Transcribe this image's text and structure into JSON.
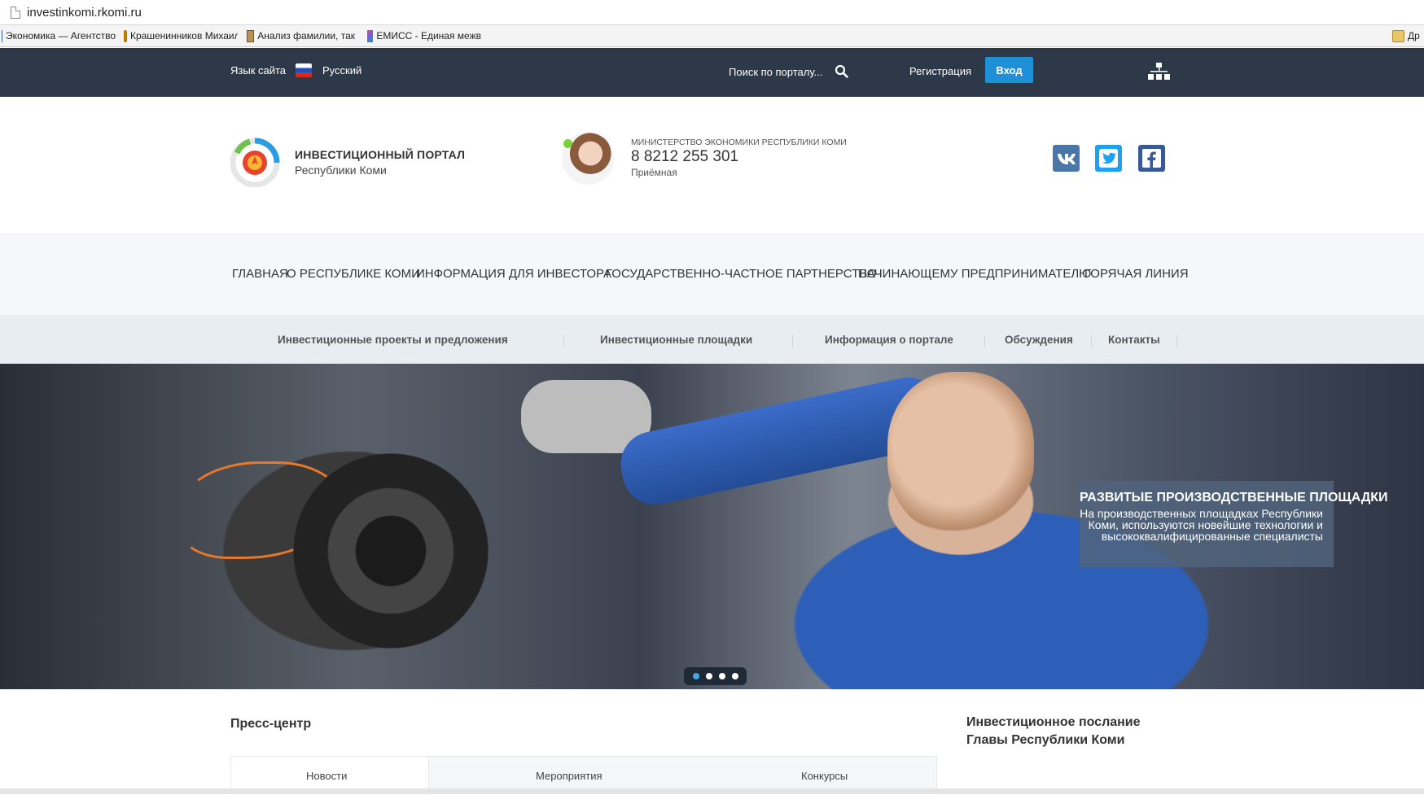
{
  "browser": {
    "url": "investinkomi.rkomi.ru",
    "bookmarks": [
      {
        "label": "Экономика — Агентство",
        "icon": "bar-chart-icon"
      },
      {
        "label": "Крашенинников Михаил",
        "icon": "odnoklassniki-icon"
      },
      {
        "label": "Анализ фамилии, так",
        "icon": "book-icon"
      },
      {
        "label": "ЕМИСС - Единая межв",
        "icon": "emiss-icon"
      },
      {
        "label": "Др",
        "icon": "folder-icon"
      }
    ]
  },
  "topbar": {
    "language_label": "Язык сайта",
    "language_value": "Русский",
    "search_placeholder": "Поиск по порталу...",
    "register_label": "Регистрация",
    "login_label": "Вход"
  },
  "header": {
    "portal_title": "ИНВЕСТИЦИОННЫЙ ПОРТАЛ",
    "portal_subtitle": "Республики Коми",
    "ministry": "МИНИСТЕРСТВО ЭКОНОМИКИ РЕСПУБЛИКИ КОМИ",
    "phone": "8 8212 255 301",
    "phone_note": "Приёмная",
    "social": [
      "vk-icon",
      "twitter-icon",
      "facebook-icon"
    ]
  },
  "main_nav": [
    "ГЛАВНАЯ",
    "О РЕСПУБЛИКЕ КОМИ",
    "ИНФОРМАЦИЯ ДЛЯ ИНВЕСТОРА",
    "ГОСУДАРСТВЕННО-ЧАСТНОЕ ПАРТНЕРСТВО",
    "НАЧИНАЮЩЕМУ ПРЕДПРИНИМАТЕЛЮ",
    "ГОРЯЧАЯ ЛИНИЯ"
  ],
  "sub_nav": [
    "Инвестиционные проекты и предложения",
    "Инвестиционные площадки",
    "Информация о портале",
    "Обсуждения",
    "Контакты"
  ],
  "hero": {
    "caption_title": "РАЗВИТЫЕ ПРОИЗВОДСТВЕННЫЕ ПЛОЩАДКИ",
    "caption_line1": "На производственных площадках Республики",
    "caption_line2": "Коми, используются новейшие технологии и",
    "caption_line3": "высококвалифицированные специалисты",
    "slides_total": 4,
    "active_slide": 1
  },
  "press": {
    "title": "Пресс-центр",
    "tabs": [
      "Новости",
      "Мероприятия",
      "Конкурсы"
    ],
    "active_tab": "Новости"
  },
  "side": {
    "message_line1": "Инвестиционное послание",
    "message_line2": "Главы Республики Коми"
  },
  "colors": {
    "topbar_bg": "#2d3848",
    "login_button": "#1e90d6",
    "vk": "#4a76a8",
    "twitter": "#1da1f2",
    "facebook": "#3b5998"
  }
}
